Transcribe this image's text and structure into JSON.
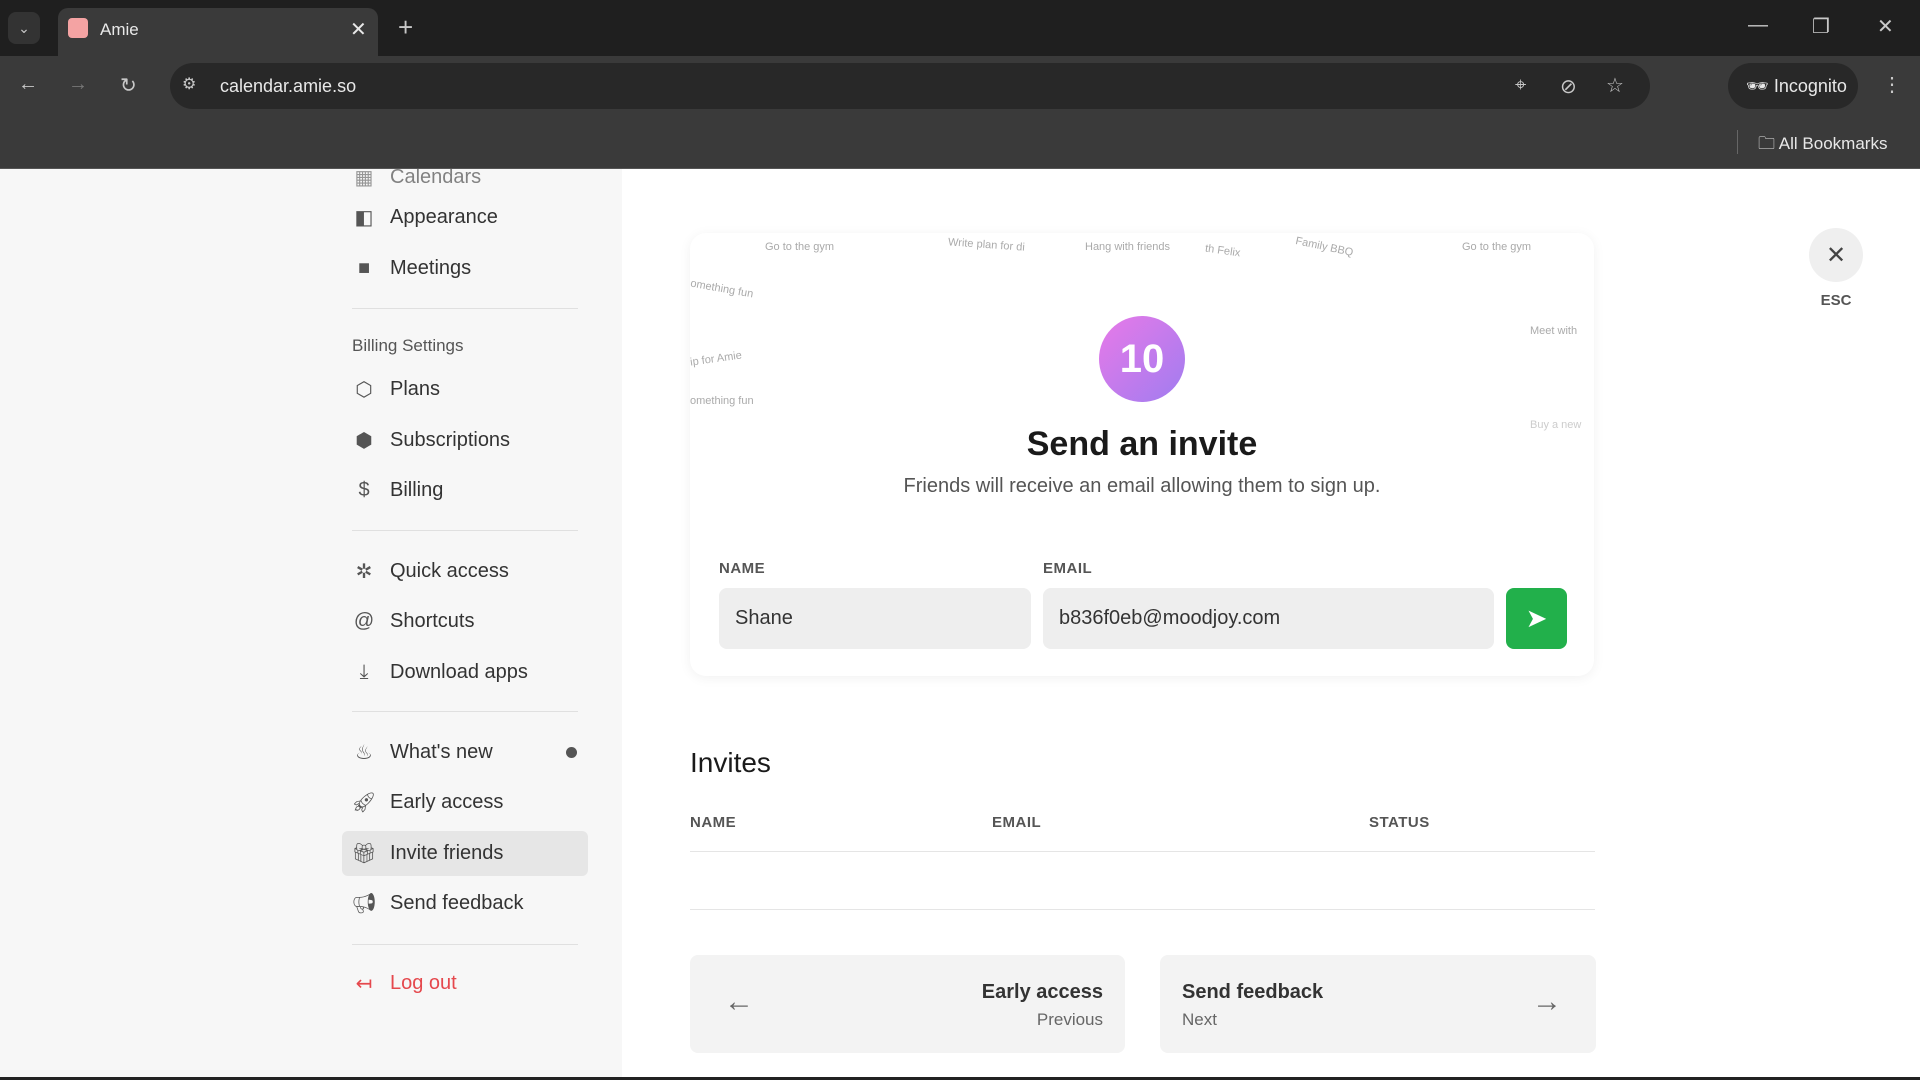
{
  "browser": {
    "tab_title": "Amie",
    "url": "calendar.amie.so",
    "incognito_label": "Incognito",
    "bookmarks_label": "All Bookmarks"
  },
  "sidebar": {
    "partial_item": "Calendars",
    "items_top": [
      {
        "label": "Appearance",
        "icon": "appearance-icon"
      },
      {
        "label": "Meetings",
        "icon": "video-icon"
      }
    ],
    "billing_heading": "Billing Settings",
    "billing_items": [
      {
        "label": "Plans",
        "icon": "plans-icon"
      },
      {
        "label": "Subscriptions",
        "icon": "box-icon"
      },
      {
        "label": "Billing",
        "icon": "dollar-icon"
      }
    ],
    "misc_items": [
      {
        "label": "Quick access",
        "icon": "quick-access-icon"
      },
      {
        "label": "Shortcuts",
        "icon": "at-icon"
      },
      {
        "label": "Download apps",
        "icon": "download-icon"
      }
    ],
    "extra_items": [
      {
        "label": "What's new",
        "icon": "flame-icon"
      },
      {
        "label": "Early access",
        "icon": "rocket-icon"
      },
      {
        "label": "Invite friends",
        "icon": "gift-icon"
      },
      {
        "label": "Send feedback",
        "icon": "megaphone-icon"
      }
    ],
    "logout": "Log out"
  },
  "invite": {
    "count": "10",
    "title": "Send an invite",
    "subtitle": "Friends will receive an email allowing them to sign up.",
    "name_label": "NAME",
    "email_label": "EMAIL",
    "name_value": "Shane",
    "email_value": "b836f0eb@moodjoy.com",
    "bg_texts": [
      "Go to the gym",
      "Write plan for di",
      "Hang with friends",
      "th Felix",
      "Family BBQ",
      "Go to the gym",
      "omething fun",
      "ip for Amie",
      "omething fun",
      "Meet with",
      "Buy a new"
    ]
  },
  "invites": {
    "heading": "Invites",
    "columns": [
      "NAME",
      "EMAIL",
      "STATUS"
    ]
  },
  "nav": {
    "prev_title": "Early access",
    "prev_sub": "Previous",
    "next_title": "Send feedback",
    "next_sub": "Next"
  },
  "close": {
    "esc_label": "ESC"
  },
  "colors": {
    "send_button": "#22b04b",
    "logout": "#e5484d",
    "badge_gradient": [
      "#a07cf0",
      "#e87ae8"
    ]
  }
}
